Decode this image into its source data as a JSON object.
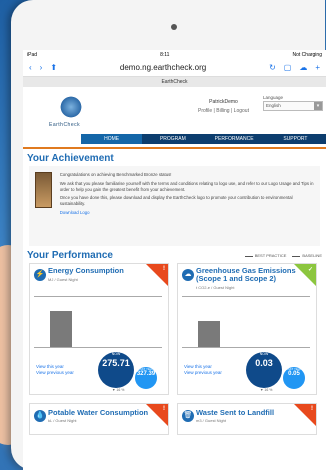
{
  "status": {
    "device": "iPad",
    "time": "8:11",
    "battery": "Not Charging"
  },
  "browser": {
    "url": "demo.ng.earthcheck.org",
    "tab_title": "EarthCheck"
  },
  "header": {
    "logo_text": "EarthCheck",
    "user": "PatrickDemo",
    "user_links": "Profile | Billing | Logout",
    "language_label": "Language",
    "language_value": "English"
  },
  "nav": [
    {
      "label": "HOME",
      "active": true
    },
    {
      "label": "PROGRAM",
      "active": false
    },
    {
      "label": "PERFORMANCE",
      "active": false
    },
    {
      "label": "SUPPORT",
      "active": false
    }
  ],
  "achievement": {
    "heading": "Your Achievement",
    "p1": "Congratulations on achieving Benchmarked Bronze status!",
    "p2": "We ask that you please familiarise yourself with the terms and conditions relating to logo use, and refer to our Logo Usage and Tips in order to help you gain the greatest benefit from your achievement.",
    "p3": "Once you have done this, please download and display the EarthCheck logo to promote your contribution to environmental sustainability.",
    "download": "Download Logo"
  },
  "performance": {
    "heading": "Your Performance",
    "legend_best": "BEST PRACTICE",
    "legend_base": "BASELINE"
  },
  "cards": [
    {
      "title": "Energy Consumption",
      "unit": "MJ / Guest Night",
      "icon": "bolt-icon",
      "status": "!",
      "now_label": "NOW",
      "now_value": "275.71",
      "last_label": "LAST YEAR",
      "last_value": "327.39",
      "change": "▼ 16 %",
      "link_year": "View this year",
      "link_prev": "View previous year"
    },
    {
      "title": "Greenhouse Gas Emissions (Scope 1 and Scope 2)",
      "unit": "t CO2-e / Guest Night",
      "icon": "co2-icon",
      "status": "✓",
      "now_label": "NOW",
      "now_value": "0.03",
      "last_label": "LAST YEAR",
      "last_value": "0.05",
      "change": "▼ 16 %",
      "link_year": "View this year",
      "link_prev": "View previous year"
    }
  ],
  "cards2": [
    {
      "title": "Potable Water Consumption",
      "unit": "kL / Guest Night",
      "icon": "water-drop-icon",
      "status": "!"
    },
    {
      "title": "Waste Sent to Landfill",
      "unit": "m3 / Guest Night",
      "icon": "trash-icon",
      "status": "!"
    }
  ]
}
